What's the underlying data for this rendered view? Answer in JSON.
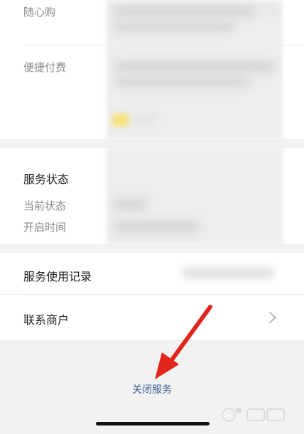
{
  "sections": {
    "top": {
      "row1_label": "随心购",
      "row2_label": "便捷付费"
    },
    "status": {
      "title": "服务状态",
      "current_status_label": "当前状态",
      "start_time_label": "开启时间"
    },
    "records": {
      "label": "服务使用记录"
    },
    "contact": {
      "label": "联系商户"
    }
  },
  "actions": {
    "close_service": "关闭服务"
  },
  "colors": {
    "background": "#f2f2f2",
    "link": "#3b5f8f",
    "annotation_arrow": "#e2261c"
  },
  "icons": {
    "chevron": "chevron-right-icon",
    "arrow": "red-arrow-annotation",
    "watermark": "baidu-jingyan-watermark"
  }
}
